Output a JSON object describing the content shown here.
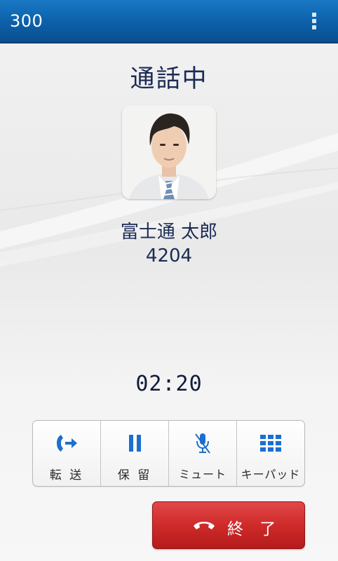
{
  "header": {
    "title": "300",
    "menu_icon": "overflow-menu-icon"
  },
  "call": {
    "status": "通話中",
    "caller_name": "富士通 太郎",
    "caller_number": "4204",
    "duration": "02:20"
  },
  "actions": [
    {
      "label": "転 送",
      "icon": "call-transfer-icon"
    },
    {
      "label": "保 留",
      "icon": "pause-icon"
    },
    {
      "label": "ミュート",
      "icon": "microphone-muted-icon"
    },
    {
      "label": "キーパッド",
      "icon": "keypad-icon"
    }
  ],
  "end_call": {
    "label": "終 了",
    "icon": "hang-up-icon"
  },
  "colors": {
    "header_blue": "#0c5fa8",
    "accent_blue": "#1a6fcf",
    "end_red": "#cf2a2a",
    "text_dark": "#1b2b55"
  }
}
